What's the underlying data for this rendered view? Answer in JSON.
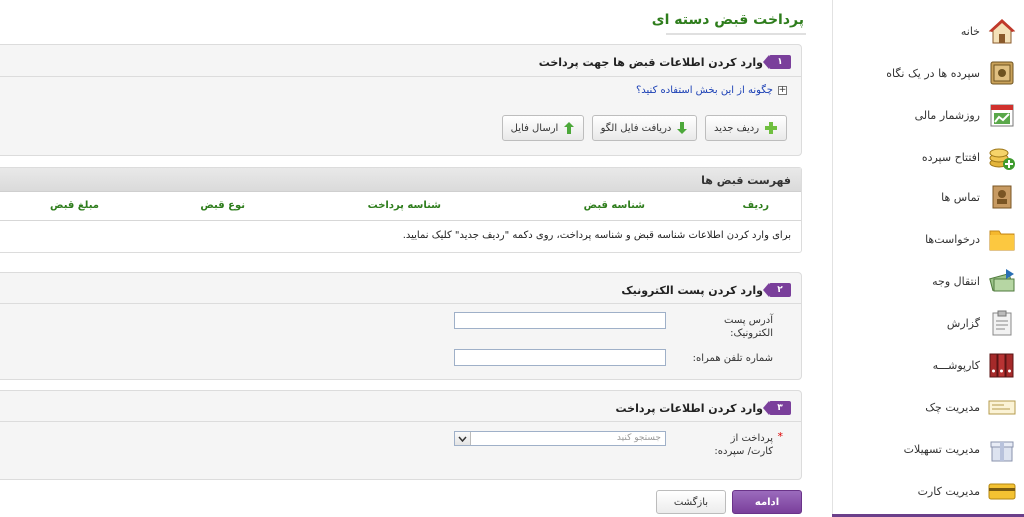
{
  "page": {
    "title": "پرداخت قبض دسته ای"
  },
  "sidebar": {
    "items": [
      {
        "label": "خانه",
        "icon": "home-icon"
      },
      {
        "label": "سپرده ها در یک نگاه",
        "icon": "safe-icon"
      },
      {
        "label": "روزشمار مالی",
        "icon": "calendar-chart-icon"
      },
      {
        "label": "افتتاح سپرده",
        "icon": "coins-add-icon"
      },
      {
        "label": "تماس ها",
        "icon": "contact-card-icon"
      },
      {
        "label": "درخواست‌ها",
        "icon": "folder-icon"
      },
      {
        "label": "انتقال وجه",
        "icon": "money-transfer-icon"
      },
      {
        "label": "گزارش",
        "icon": "clipboard-icon"
      },
      {
        "label": "کارپوشـــه",
        "icon": "binders-icon"
      },
      {
        "label": "مدیریت چک",
        "icon": "cheque-icon"
      },
      {
        "label": "مدیریت تسهیلات",
        "icon": "gift-icon"
      },
      {
        "label": "مدیریت کارت",
        "icon": "card-icon"
      }
    ]
  },
  "step1": {
    "badge": "۱",
    "title": "وارد کردن اطلاعات قبض ها جهت پرداخت",
    "help_link": "چگونه از این بخش استفاده کنید؟",
    "buttons": {
      "new_row": "ردیف جدید",
      "download_template": "دریافت فایل الگو",
      "upload_file": "ارسال فایل"
    }
  },
  "bill_list": {
    "title": "فهرست قبض ها",
    "columns": [
      "ردیف",
      "شناسه قبض",
      "شناسه پرداخت",
      "نوع قبض",
      "مبلغ قبض"
    ],
    "empty_message": "برای وارد کردن اطلاعات شناسه قبض و شناسه پرداخت، روی دکمه \"ردیف جدید\" کلیک نمایید."
  },
  "step2": {
    "badge": "۲",
    "title": "وارد کردن پست الکترونیک",
    "email_label": "آدرس پست الکترونیک:",
    "email_value": "",
    "mobile_label": "شماره تلفن همراه:",
    "mobile_value": ""
  },
  "step3": {
    "badge": "۳",
    "title": "وارد کردن اطلاعات پرداخت",
    "required_mark": "*",
    "pay_from_label": "پرداخت از کارت/ سپرده:",
    "pay_from_placeholder": "جستجو کنید"
  },
  "actions": {
    "continue": "ادامه",
    "back": "بازگشت"
  },
  "colors": {
    "accent_purple": "#7a3f9b",
    "title_green": "#2e7d1c",
    "link_blue": "#1a3fb5"
  }
}
